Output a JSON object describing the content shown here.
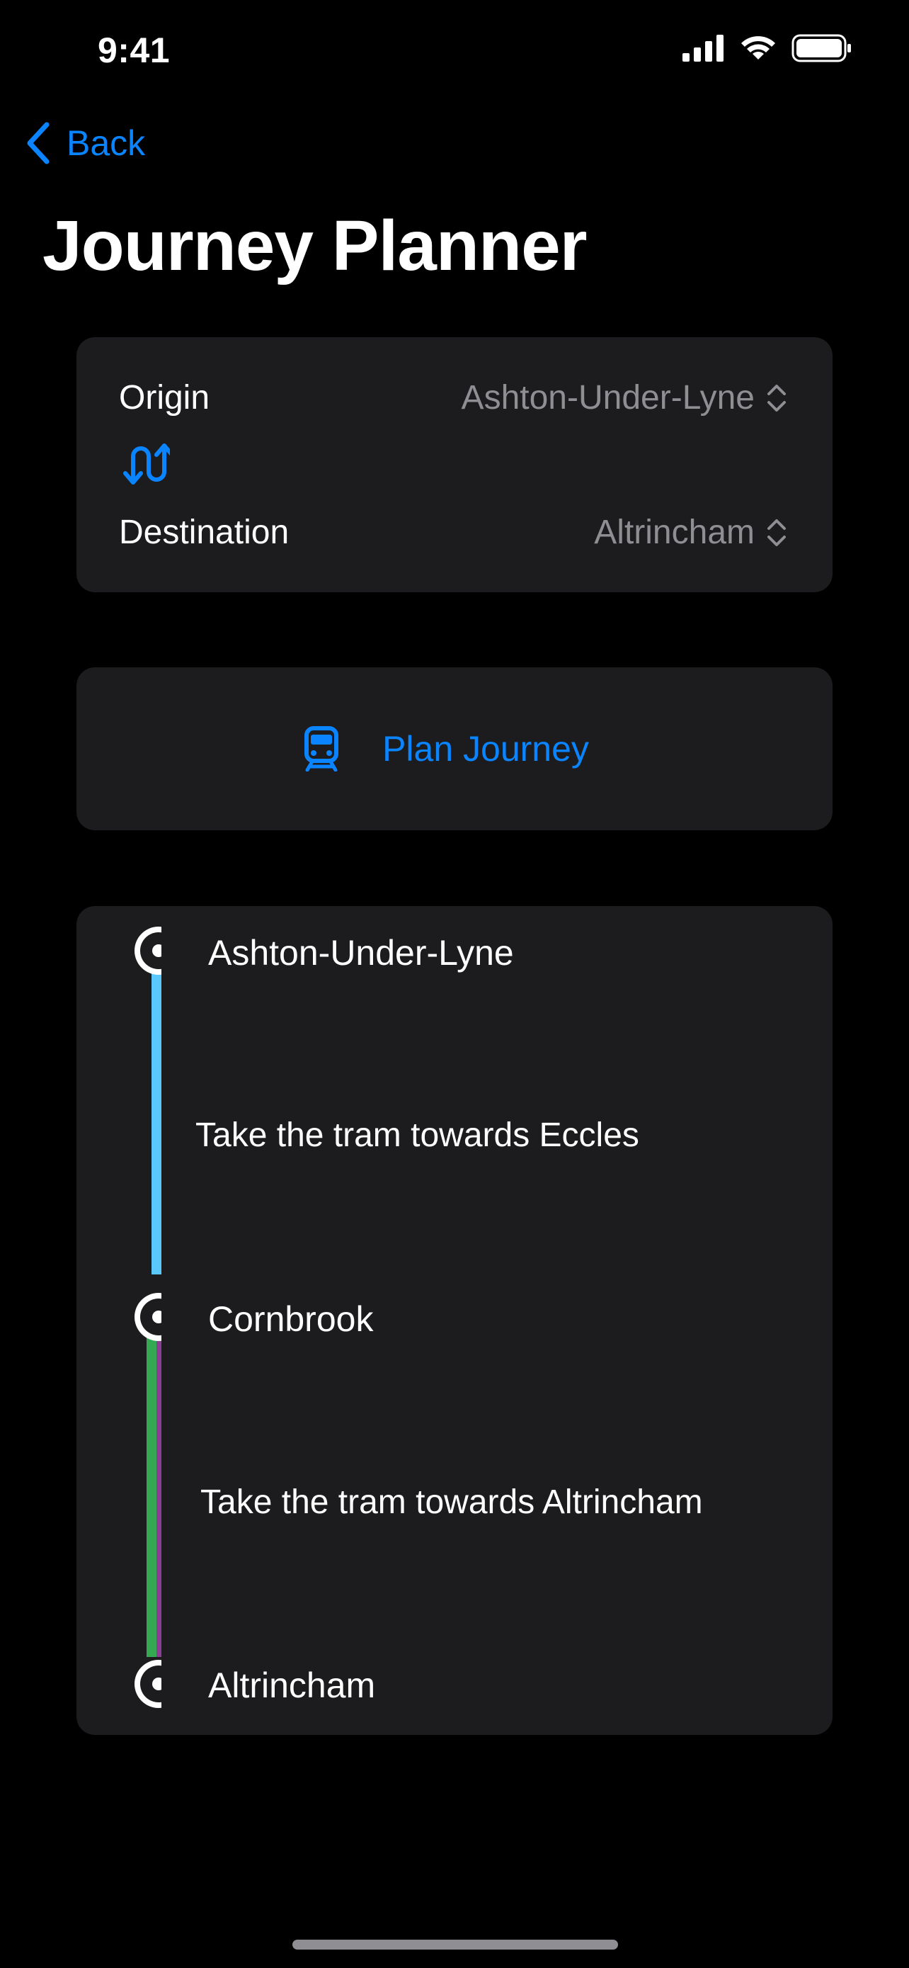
{
  "status": {
    "time": "9:41"
  },
  "nav": {
    "back_label": "Back"
  },
  "title": "Journey Planner",
  "form": {
    "origin_label": "Origin",
    "origin_value": "Ashton-Under-Lyne",
    "destination_label": "Destination",
    "destination_value": "Altrincham"
  },
  "plan_button": {
    "label": "Plan Journey"
  },
  "journey": {
    "stops": [
      "Ashton-Under-Lyne",
      "Cornbrook",
      "Altrincham"
    ],
    "steps": [
      "Take the tram towards Eccles",
      "Take the tram towards Altrincham"
    ],
    "line_colors": {
      "leg1": "#5AC8FA",
      "leg2_a": "#34A853",
      "leg2_b": "#8E3D97"
    }
  },
  "colors": {
    "accent": "#0A84FF",
    "card": "#1C1C1E",
    "secondary_text": "#8E8E93"
  }
}
